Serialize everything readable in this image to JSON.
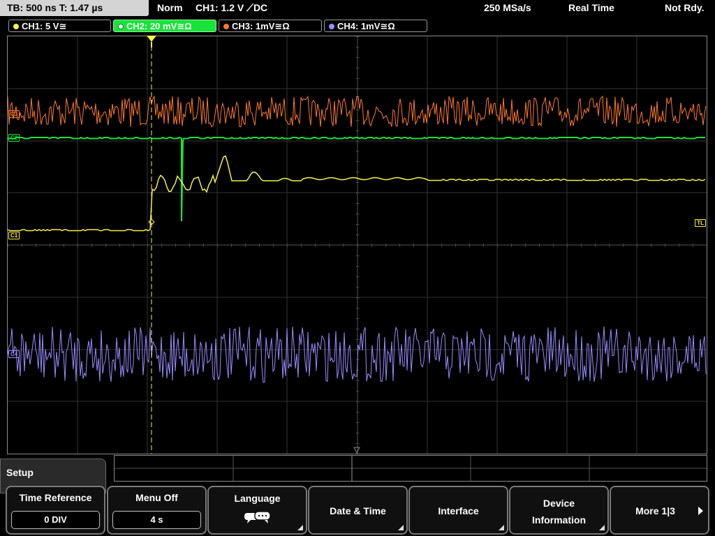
{
  "topbar": {
    "timebase": "TB: 500 ns   T: 1.47 µs",
    "mode": "Norm",
    "trigger": "CH1: 1.2 V ⟋DC",
    "sample_rate": "250 MSa/s",
    "acq_mode": "Real Time",
    "status": "Not Rdy."
  },
  "channels": [
    {
      "label": "CH1: 5 V≅",
      "color": "#f6f24a"
    },
    {
      "label": "CH2: 20 mV≅Ω",
      "color": "#19e33a"
    },
    {
      "label": "CH3: 1mV≅Ω",
      "color": "#ff7a2a"
    },
    {
      "label": "CH4: 1mV≅Ω",
      "color": "#9a8cff"
    }
  ],
  "markers": {
    "c1": "C1",
    "c2": "C2",
    "c3": "C3",
    "c4": "C4",
    "tl": "TL",
    "trigger": "T"
  },
  "menu": {
    "title": "Setup",
    "softkeys": [
      {
        "label": "Time Reference",
        "value": "0 DIV"
      },
      {
        "label": "Menu Off",
        "value": "4 s"
      },
      {
        "label": "Language",
        "icon": "speech-bubble-icon"
      },
      {
        "label": "Date & Time"
      },
      {
        "label": "Interface"
      },
      {
        "label": "Device",
        "label2": "Information"
      },
      {
        "label": "More 1|3"
      }
    ]
  }
}
